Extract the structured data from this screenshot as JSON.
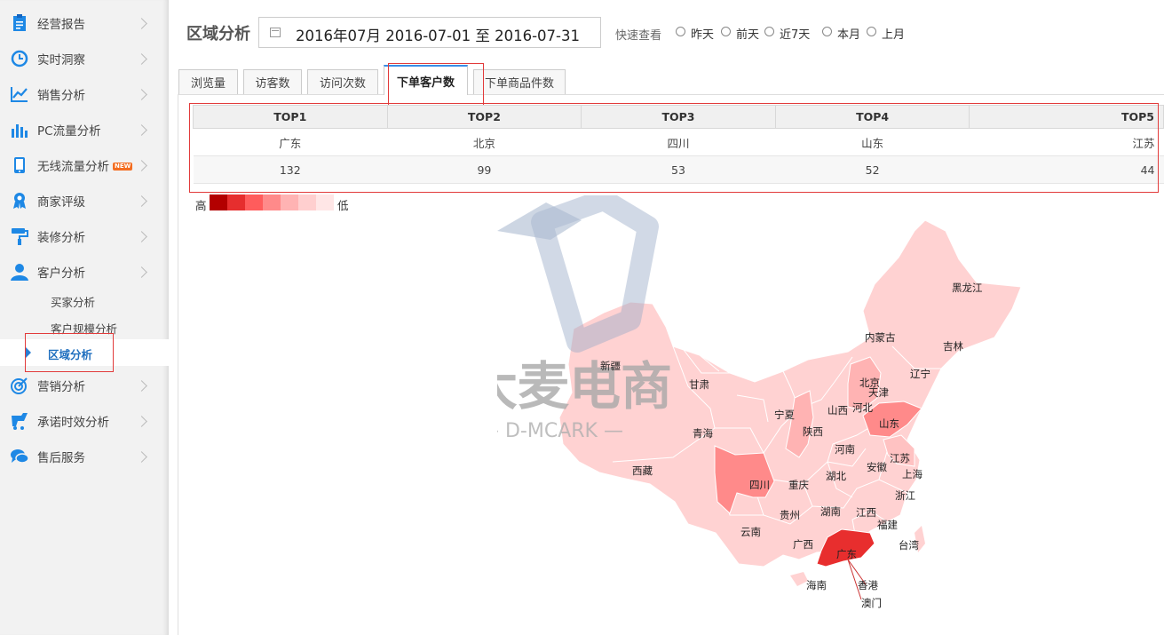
{
  "sidebar": {
    "items": [
      {
        "label": "经营报告",
        "icon": "report-icon"
      },
      {
        "label": "实时洞察",
        "icon": "clock-icon"
      },
      {
        "label": "销售分析",
        "icon": "line-chart-icon"
      },
      {
        "label": "PC流量分析",
        "icon": "bar-chart-icon"
      },
      {
        "label": "无线流量分析",
        "icon": "mobile-icon",
        "badge": "NEW"
      },
      {
        "label": "商家评级",
        "icon": "ribbon-icon"
      },
      {
        "label": "装修分析",
        "icon": "paint-roller-icon"
      },
      {
        "label": "客户分析",
        "icon": "user-icon"
      },
      {
        "label": "营销分析",
        "icon": "target-icon"
      },
      {
        "label": "承诺时效分析",
        "icon": "delivery-icon"
      },
      {
        "label": "售后服务",
        "icon": "chat-icon"
      }
    ],
    "sub_items": [
      "买家分析",
      "客户规模分析",
      "区域分析"
    ],
    "active_sub": "区域分析"
  },
  "header": {
    "title": "区域分析",
    "date_range": "2016年07月 2016-07-01 至 2016-07-31",
    "quick_label": "快速查看",
    "quick_options": [
      "昨天",
      "前天",
      "近7天",
      "本月",
      "上月"
    ]
  },
  "tabs": [
    "浏览量",
    "访客数",
    "访问次数",
    "下单客户数",
    "下单商品件数"
  ],
  "active_tab": "下单客户数",
  "table": {
    "headers": [
      "TOP1",
      "TOP2",
      "TOP3",
      "TOP4",
      "TOP5"
    ],
    "regions": [
      "广东",
      "北京",
      "四川",
      "山东",
      "江苏"
    ],
    "values": [
      "132",
      "99",
      "53",
      "52",
      "44"
    ]
  },
  "legend": {
    "high": "高",
    "low": "低",
    "colors": [
      "#b30000",
      "#e62e2e",
      "#ff5c5c",
      "#ff8a8a",
      "#ffb3b3",
      "#ffcfcf",
      "#ffe6e6"
    ]
  },
  "watermark": {
    "main": "大麦电商",
    "sub": "— D-MCARK —"
  },
  "map_labels": [
    "黑龙江",
    "吉林",
    "内蒙古",
    "辽宁",
    "新疆",
    "甘肃",
    "北京",
    "天津",
    "河北",
    "山西",
    "宁夏",
    "山东",
    "青海",
    "陕西",
    "河南",
    "江苏",
    "安徽",
    "上海",
    "西藏",
    "四川",
    "重庆",
    "湖北",
    "浙江",
    "贵州",
    "湖南",
    "江西",
    "云南",
    "福建",
    "广西",
    "台湾",
    "广东",
    "海南",
    "香港",
    "澳门"
  ]
}
